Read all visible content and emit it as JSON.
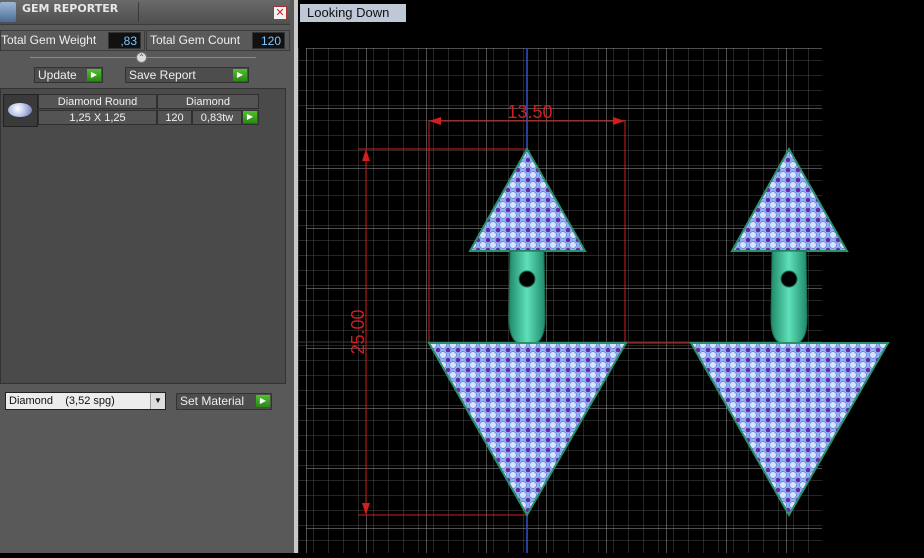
{
  "panel": {
    "title": "GEM REPORTER",
    "close_glyph": "✕",
    "total_weight_label": "Total Gem Weight",
    "total_weight_value": ",83",
    "total_count_label": "Total Gem Count",
    "total_count_value": "120",
    "update_label": "Update",
    "save_report_label": "Save Report"
  },
  "gem_table": {
    "header_name": "Diamond Round",
    "header_material": "Diamond",
    "row_size": "1,25 X 1,25",
    "row_count": "120",
    "row_weight": "0,83tw"
  },
  "material": {
    "selected": "Diamond    (3,52 spg)",
    "set_label": "Set Material"
  },
  "viewport": {
    "tab_label": "Looking Down",
    "dim_width": "13.50",
    "dim_height": "25.00"
  },
  "colors": {
    "panel_bg": "#595959",
    "accent_play": "#2f9f17",
    "dim_color": "#d21e1e",
    "grid": "#8a8a8a",
    "metal": "#2fae8a",
    "gem_field": "#8fb3ff",
    "gem_dots": "#6a2a9a"
  }
}
